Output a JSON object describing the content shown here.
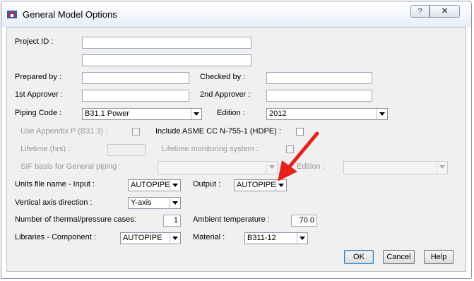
{
  "window": {
    "title": "General Model Options",
    "help_glyph": "?",
    "close_glyph": "✕"
  },
  "fields": {
    "project_id": {
      "label": "Project ID   :",
      "value": ""
    },
    "project_id_2": {
      "value": ""
    },
    "prepared_by": {
      "label": "Prepared by  :",
      "value": ""
    },
    "checked_by": {
      "label": "Checked by  :",
      "value": ""
    },
    "first_approver": {
      "label": "1st Approver :",
      "value": ""
    },
    "second_approver": {
      "label": "2nd Approver :",
      "value": ""
    },
    "piping_code": {
      "label": "Piping Code   :",
      "value": "B31.1 Power"
    },
    "edition": {
      "label": "Edition :",
      "value": "2012"
    },
    "use_appendix_p": {
      "label": "Use Appendix P (B31.3) :",
      "checked": false
    },
    "include_asme": {
      "label": "Include ASME CC N-755-1 (HDPE) :",
      "checked": false
    },
    "lifetime": {
      "label": "Lifetime (hrs) :",
      "value": ""
    },
    "lifetime_monitoring": {
      "label": "Lifetime monitoring system :",
      "checked": false
    },
    "sif_basis": {
      "label": "SIF basis for General piping :",
      "value": ""
    },
    "sif_edition": {
      "label": "Edition :",
      "value": ""
    },
    "units_input": {
      "label": "Units file name - Input :",
      "value": "AUTOPIPE"
    },
    "units_output": {
      "label": "Output :",
      "value": "AUTOPIPE"
    },
    "vertical_axis": {
      "label": "Vertical axis direction :",
      "value": "Y-axis"
    },
    "num_cases": {
      "label": "Number of thermal/pressure cases:",
      "value": "1"
    },
    "ambient_temp": {
      "label": "Ambient temperature :",
      "value": "70.0"
    },
    "libraries_component": {
      "label": "Libraries - Component :",
      "value": "AUTOPIPE"
    },
    "material": {
      "label": "Material :",
      "value": "B311-12"
    }
  },
  "buttons": {
    "ok": "OK",
    "cancel": "Cancel",
    "help": "Help"
  },
  "icons": {
    "app": "app-icon",
    "arrow": "red-annotation-arrow"
  },
  "colors": {
    "annotation": "#e8201a",
    "titlebar": "#f2f5fa",
    "dialog_bg": "#f0f0f0"
  }
}
